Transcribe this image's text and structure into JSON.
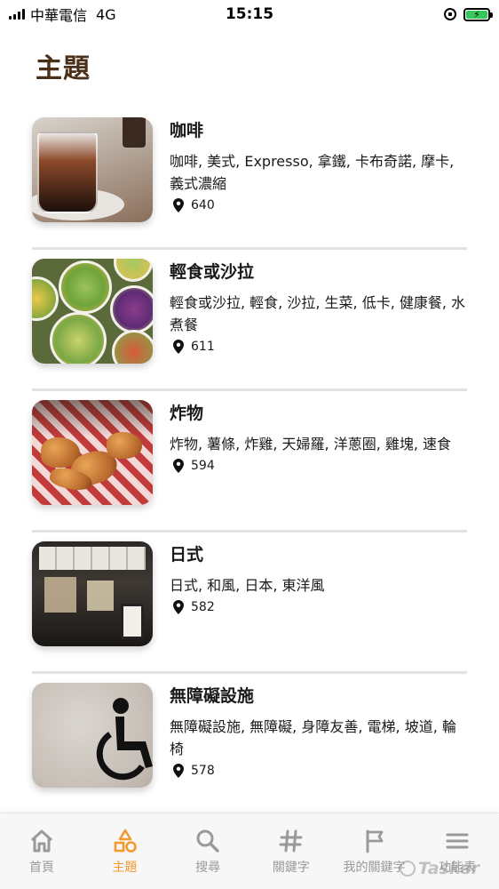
{
  "status_bar": {
    "carrier": "中華電信",
    "network": "4G",
    "time": "15:15"
  },
  "page_title": "主題",
  "topics": [
    {
      "name": "咖啡",
      "keywords": "咖啡, 美式, Expresso, 拿鐵, 卡布奇諾, 摩卡, 義式濃縮",
      "count": "640"
    },
    {
      "name": "輕食或沙拉",
      "keywords": "輕食或沙拉, 輕食, 沙拉, 生菜, 低卡, 健康餐, 水煮餐",
      "count": "611"
    },
    {
      "name": "炸物",
      "keywords": "炸物, 薯條, 炸雞, 天婦羅, 洋蔥圈, 雞塊, 速食",
      "count": "594"
    },
    {
      "name": "日式",
      "keywords": "日式, 和風, 日本, 東洋風",
      "count": "582"
    },
    {
      "name": "無障礙設施",
      "keywords": "無障礙設施, 無障礙, 身障友善, 電梯, 坡道, 輪椅",
      "count": "578"
    }
  ],
  "tabs": [
    {
      "label": "首頁",
      "icon": "home-icon"
    },
    {
      "label": "主題",
      "icon": "shapes-icon",
      "active": true
    },
    {
      "label": "搜尋",
      "icon": "search-icon"
    },
    {
      "label": "關鍵字",
      "icon": "hashtag-icon"
    },
    {
      "label": "我的關鍵字",
      "icon": "flag-icon"
    },
    {
      "label": "功能表",
      "icon": "menu-icon"
    }
  ],
  "watermark": "Tasker",
  "colors": {
    "title": "#4a2f19",
    "active_tab": "#f29a2e",
    "inactive_tab": "#9a9a9a",
    "battery": "#34c759"
  }
}
